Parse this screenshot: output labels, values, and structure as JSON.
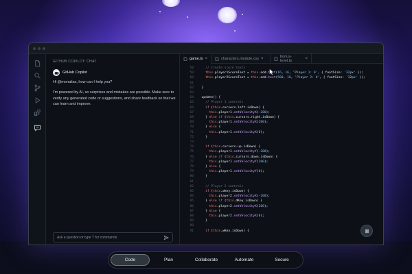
{
  "chat": {
    "title": "GITHUB COPILOT: CHAT",
    "sender": "GitHub Copilot",
    "greeting": "Hi @monalisa, how can I help you?",
    "disclaimer": "I'm powered by AI, so surprises and mistakes are possible. Make sure to verify any generated code or suggestions, and share feedback so that we can learn and improve.",
    "input_placeholder": "Ask a question or type '/' for commands"
  },
  "editor": {
    "tabs": [
      {
        "label": "game.ts",
        "active": true
      },
      {
        "label": "characters.module.css",
        "active": false
      },
      {
        "label": "bonus-level.ts",
        "active": false
      }
    ],
    "close_glyph": "×",
    "lines": [
      {
        "n": "58",
        "code": "    // Create score texts"
      },
      {
        "n": "59",
        "code": "    this.player1ScoreText = this.add.text(16, 16, 'Player 1: 0', { fontSize: '32px' });"
      },
      {
        "n": "60",
        "code": "    this.player2ScoreText = this.add.text(500, 16, 'Player 2: 0', { fontSize: '32px' });"
      },
      {
        "n": "61",
        "code": ""
      },
      {
        "n": "62",
        "code": "  }"
      },
      {
        "n": "63",
        "code": ""
      },
      {
        "n": "64",
        "code": "  update() {"
      },
      {
        "n": "65",
        "code": "    // Player 1 controls"
      },
      {
        "n": "66",
        "code": "    if (this.cursors.left.isDown) {"
      },
      {
        "n": "67",
        "code": "      this.player1.setVelocityX(-200);"
      },
      {
        "n": "68",
        "code": "    } else if (this.cursors.right.isDown) {"
      },
      {
        "n": "69",
        "code": "      this.player1.setVelocityX(200);"
      },
      {
        "n": "70",
        "code": "    } else {"
      },
      {
        "n": "71",
        "code": "      this.player1.setVelocityX(0);"
      },
      {
        "n": "72",
        "code": "    }"
      },
      {
        "n": "73",
        "code": ""
      },
      {
        "n": "74",
        "code": "    if (this.cursors.up.isDown) {"
      },
      {
        "n": "75",
        "code": "      this.player1.setVelocityY(-200);"
      },
      {
        "n": "76",
        "code": "    } else if (this.cursors.down.isDown) {"
      },
      {
        "n": "77",
        "code": "      this.player1.setVelocityY(200);"
      },
      {
        "n": "78",
        "code": "    } else {"
      },
      {
        "n": "79",
        "code": "      this.player1.setVelocityY(0);"
      },
      {
        "n": "80",
        "code": "    }"
      },
      {
        "n": "81",
        "code": ""
      },
      {
        "n": "82",
        "code": "    // Player 2 controls"
      },
      {
        "n": "83",
        "code": "    if (this.wkey.isDown) {"
      },
      {
        "n": "84",
        "code": "      this.player2.setVelocityX(-200);"
      },
      {
        "n": "85",
        "code": "    } else if (this.dKey.isDown) {"
      },
      {
        "n": "86",
        "code": "      this.player2.setVelocityX(200);"
      },
      {
        "n": "87",
        "code": "    } else {"
      },
      {
        "n": "88",
        "code": "      this.player2.setVelocityX(0);"
      },
      {
        "n": "89",
        "code": "    }"
      },
      {
        "n": "90",
        "code": ""
      },
      {
        "n": "91",
        "code": "    if (this.wKey.isDown) {"
      }
    ]
  },
  "nav": {
    "items": [
      {
        "label": "Code",
        "active": true
      },
      {
        "label": "Plan",
        "active": false
      },
      {
        "label": "Collaborate",
        "active": false
      },
      {
        "label": "Automate",
        "active": false
      },
      {
        "label": "Secure",
        "active": false
      }
    ]
  },
  "colors": {
    "accent_glow": "#9670ff",
    "keyword": "#ff7b72",
    "function": "#d2a8ff",
    "string": "#a5d6ff",
    "comment": "#6a737d"
  },
  "icons": [
    "files-icon",
    "search-icon",
    "source-control-icon",
    "run-debug-icon",
    "extensions-icon",
    "copilot-chat-icon",
    "copilot-avatar-icon",
    "send-icon",
    "pause-icon",
    "mouse-pointer-icon"
  ]
}
